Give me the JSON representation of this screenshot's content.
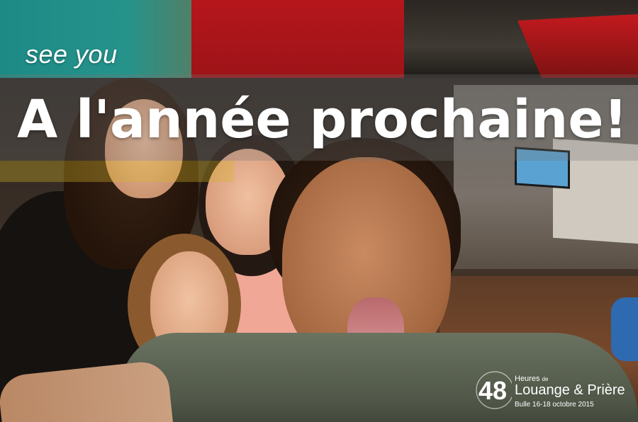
{
  "overlay": {
    "tagline": "see you",
    "headline": "A l'année prochaine!"
  },
  "logo": {
    "mark": "48",
    "heures": "Heures",
    "de": "de",
    "name": "Louange & Prière",
    "date": "Bulle 16-18 octobre 2015"
  },
  "colors": {
    "text": "#ffffff",
    "band_teal": "#26938b",
    "band_red": "#b5161c",
    "band_yellow": "#d6b428"
  }
}
